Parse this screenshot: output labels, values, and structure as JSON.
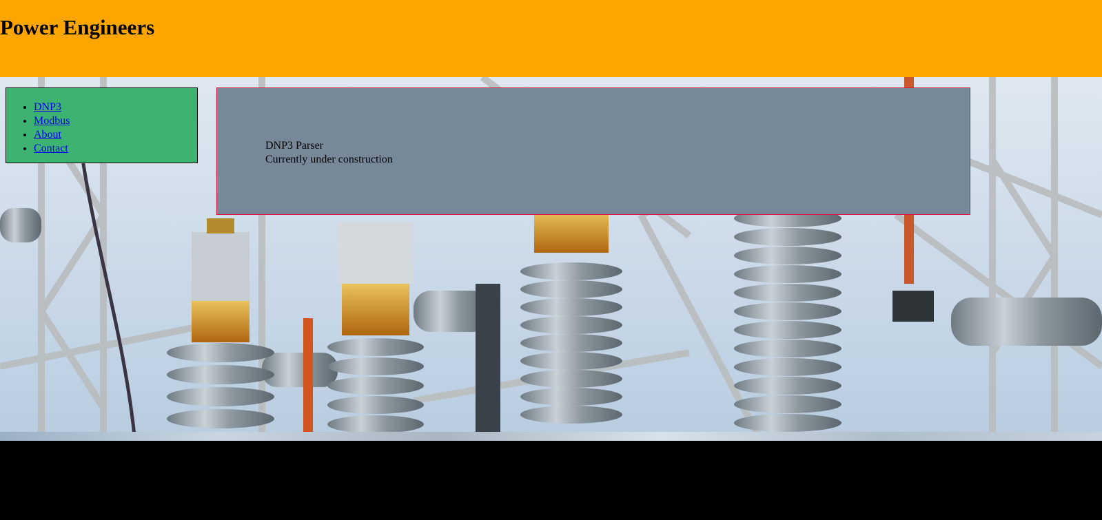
{
  "header": {
    "title": "Power Engineers",
    "background_color": "#ffa500"
  },
  "nav": {
    "background_color": "#3cb371",
    "items": [
      {
        "label": "DNP3"
      },
      {
        "label": "Modbus"
      },
      {
        "label": "About"
      },
      {
        "label": "Contact"
      }
    ]
  },
  "content": {
    "background_color": "#778899",
    "border_color": "#dc143c",
    "heading": "DNP3 Parser",
    "status": "Currently under construction"
  },
  "hero": {
    "image": "electrical-substation-insulators-image"
  },
  "footer": {
    "background_color": "#000000"
  }
}
